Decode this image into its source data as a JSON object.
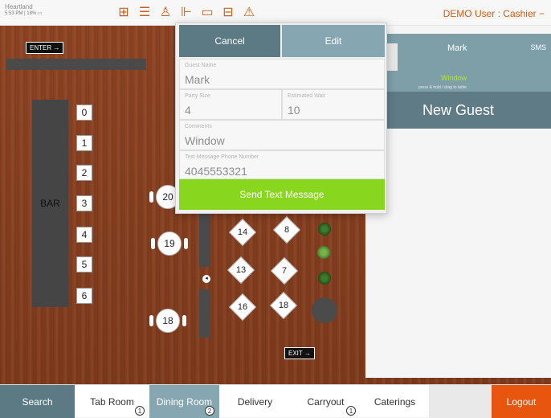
{
  "header": {
    "brand": "Heartland",
    "status": "5:53 PM | 18% ▭",
    "user": "DEMO User : Cashier −",
    "icons": [
      "grid-icon",
      "stack-icon",
      "person-icon",
      "chart-icon",
      "monitor-icon",
      "table-icon",
      "alert-icon"
    ]
  },
  "floor": {
    "enter": "ENTER →",
    "exit": "EXIT →",
    "bar_label": "BAR",
    "stools": [
      "0",
      "1",
      "2",
      "3",
      "4",
      "5",
      "6"
    ],
    "round_tables": [
      "20",
      "19",
      "18"
    ],
    "diamond_tables": [
      "14",
      "8",
      "13",
      "7",
      "16",
      "18"
    ]
  },
  "popup": {
    "cancel": "Cancel",
    "edit": "Edit",
    "guest_name_label": "Guest Name",
    "guest_name": "Mark",
    "party_size_label": "Party Size",
    "party_size": "4",
    "wait_label": "Estimated Wait",
    "wait": "10",
    "comments_label": "Comments",
    "comments": "Window",
    "phone_label": "Text Message Phone Number",
    "phone": "4045553321",
    "send": "Send Text Message"
  },
  "waitlist": {
    "name": "Mark",
    "sms": "SMS",
    "note": "Window",
    "hint": "press & hold / drag to table",
    "new_guest": "New Guest"
  },
  "nav": {
    "search": "Search",
    "tab_room": "Tab Room",
    "tab_room_badge": "1",
    "dining_room": "Dining Room",
    "dining_room_badge": "2",
    "delivery": "Delivery",
    "carryout": "Carryout",
    "carryout_badge": "1",
    "caterings": "Caterings",
    "logout": "Logout"
  },
  "colors": {
    "accent": "#5b7a84",
    "accent_light": "#86a7b1",
    "send_green": "#88d61e",
    "logout_orange": "#e8550f",
    "floor_wood": "#8e4422"
  }
}
